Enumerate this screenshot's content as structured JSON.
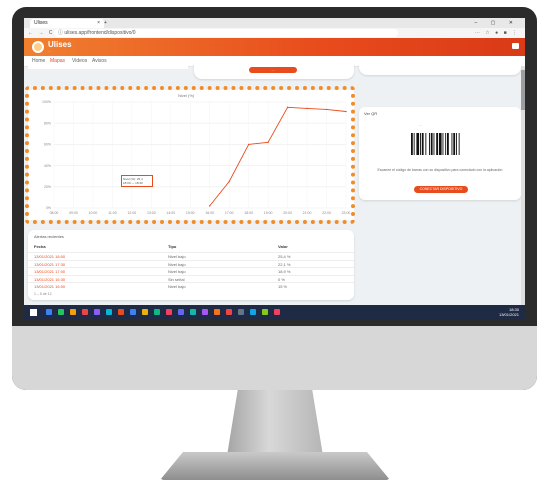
{
  "browser": {
    "tab_title": "Ulises",
    "tab_close": "×",
    "new_tab": "+",
    "window_controls": "– ▢ ✕",
    "nav_icons": "← → C ⌂",
    "url": "ⓘ ulises.app/frontend/dispositivo/0",
    "ext_icons": "⋯ ☆ ● ■ ⋮"
  },
  "app": {
    "name": "Ulises",
    "subtitle": "..."
  },
  "nav": {
    "tabs": [
      "Home",
      "Mapas",
      "Videos",
      "Avisos"
    ]
  },
  "summary": {
    "pill_label": "..."
  },
  "chart_data": {
    "type": "line",
    "title": "Nivel (%)",
    "x": [
      "08:00",
      "09:00",
      "10:00",
      "11:00",
      "12:00",
      "13:00",
      "14:00",
      "15:00",
      "16:00",
      "17:00",
      "18:00",
      "19:00",
      "20:00",
      "21:00",
      "22:00",
      "23:00"
    ],
    "series": [
      {
        "name": "",
        "values": [
          null,
          null,
          null,
          null,
          null,
          null,
          null,
          null,
          2,
          25,
          60,
          62,
          95,
          94,
          93,
          91
        ]
      }
    ],
    "yticks": [
      "100%",
      "80%",
      "60%",
      "40%",
      "20%",
      "0%"
    ],
    "ylim": [
      0,
      100
    ],
    "grid": true,
    "tooltip_lines": [
      "Nivel (%): 25,4",
      "18:00 — 18:30"
    ],
    "accent": "#e84b1c"
  },
  "barcode_card": {
    "title": "Ver QR",
    "code_label": "...",
    "description": "Escanee el código de barras con su dispositivo para conectarlo con la aplicación",
    "button_label": "CONECTAR DISPOSITIVO"
  },
  "table": {
    "title": "Alertas recientes",
    "headers": [
      "Fecha",
      "Tipo",
      "Valor"
    ],
    "rows": [
      [
        "13/01/2021 18:00",
        "Nivel bajo",
        "25,4 %"
      ],
      [
        "13/01/2021 17:30",
        "Nivel bajo",
        "22,1 %"
      ],
      [
        "13/01/2021 17:00",
        "Nivel bajo",
        "18,9 %"
      ],
      [
        "13/01/2021 16:30",
        "Sin señal",
        "0 %"
      ],
      [
        "13/01/2021 16:00",
        "Nivel bajo",
        "15 %"
      ]
    ],
    "pager": "1 – 5 de 12"
  },
  "taskbar": {
    "time": "18:30",
    "date": "13/01/2021",
    "icon_colors": [
      "#3b82f6",
      "#22c55e",
      "#f59e0b",
      "#ef4444",
      "#8b5cf6",
      "#06b6d4",
      "#e84b1c",
      "#3b82f6",
      "#eab308",
      "#10b981",
      "#f43f5e",
      "#6366f1",
      "#14b8a6",
      "#a855f7",
      "#f97316",
      "#ef4444",
      "#64748b",
      "#0ea5e9",
      "#84cc16",
      "#f43f5e"
    ]
  }
}
